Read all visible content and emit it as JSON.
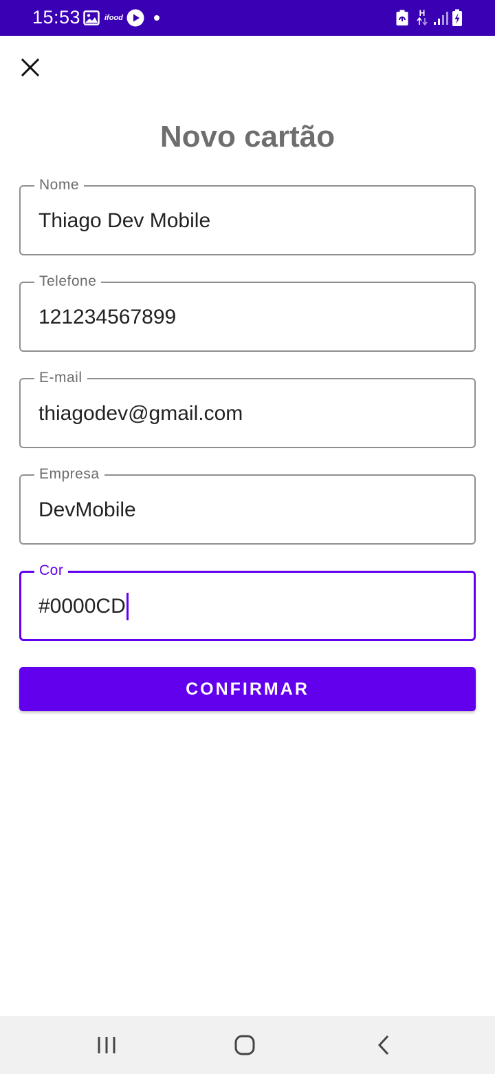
{
  "status_bar": {
    "time": "15:53",
    "ifood_label": "ifood",
    "network_label": "H",
    "icons": [
      "image-icon",
      "ifood-icon",
      "play-icon",
      "dot-icon",
      "battery-saver-icon",
      "network-h-icon",
      "signal-icon",
      "battery-charging-icon"
    ],
    "background": "#3a00b3"
  },
  "header": {
    "close_icon": "close-icon",
    "title": "Novo cartão"
  },
  "form": {
    "fields": [
      {
        "label": "Nome",
        "value": "Thiago Dev Mobile"
      },
      {
        "label": "Telefone",
        "value": "121234567899"
      },
      {
        "label": "E-mail",
        "value": "thiagodev@gmail.com"
      },
      {
        "label": "Empresa",
        "value": "DevMobile"
      },
      {
        "label": "Cor",
        "value": "#0000CD"
      }
    ],
    "focused_field": "Cor",
    "confirm_label": "CONFIRMAR"
  },
  "colors": {
    "accent": "#6200ee",
    "title_gray": "#6e6e6e",
    "border_gray": "#8f8f8f"
  },
  "nav_bar": {
    "icons": [
      "recent-apps-icon",
      "home-icon",
      "back-icon"
    ]
  }
}
